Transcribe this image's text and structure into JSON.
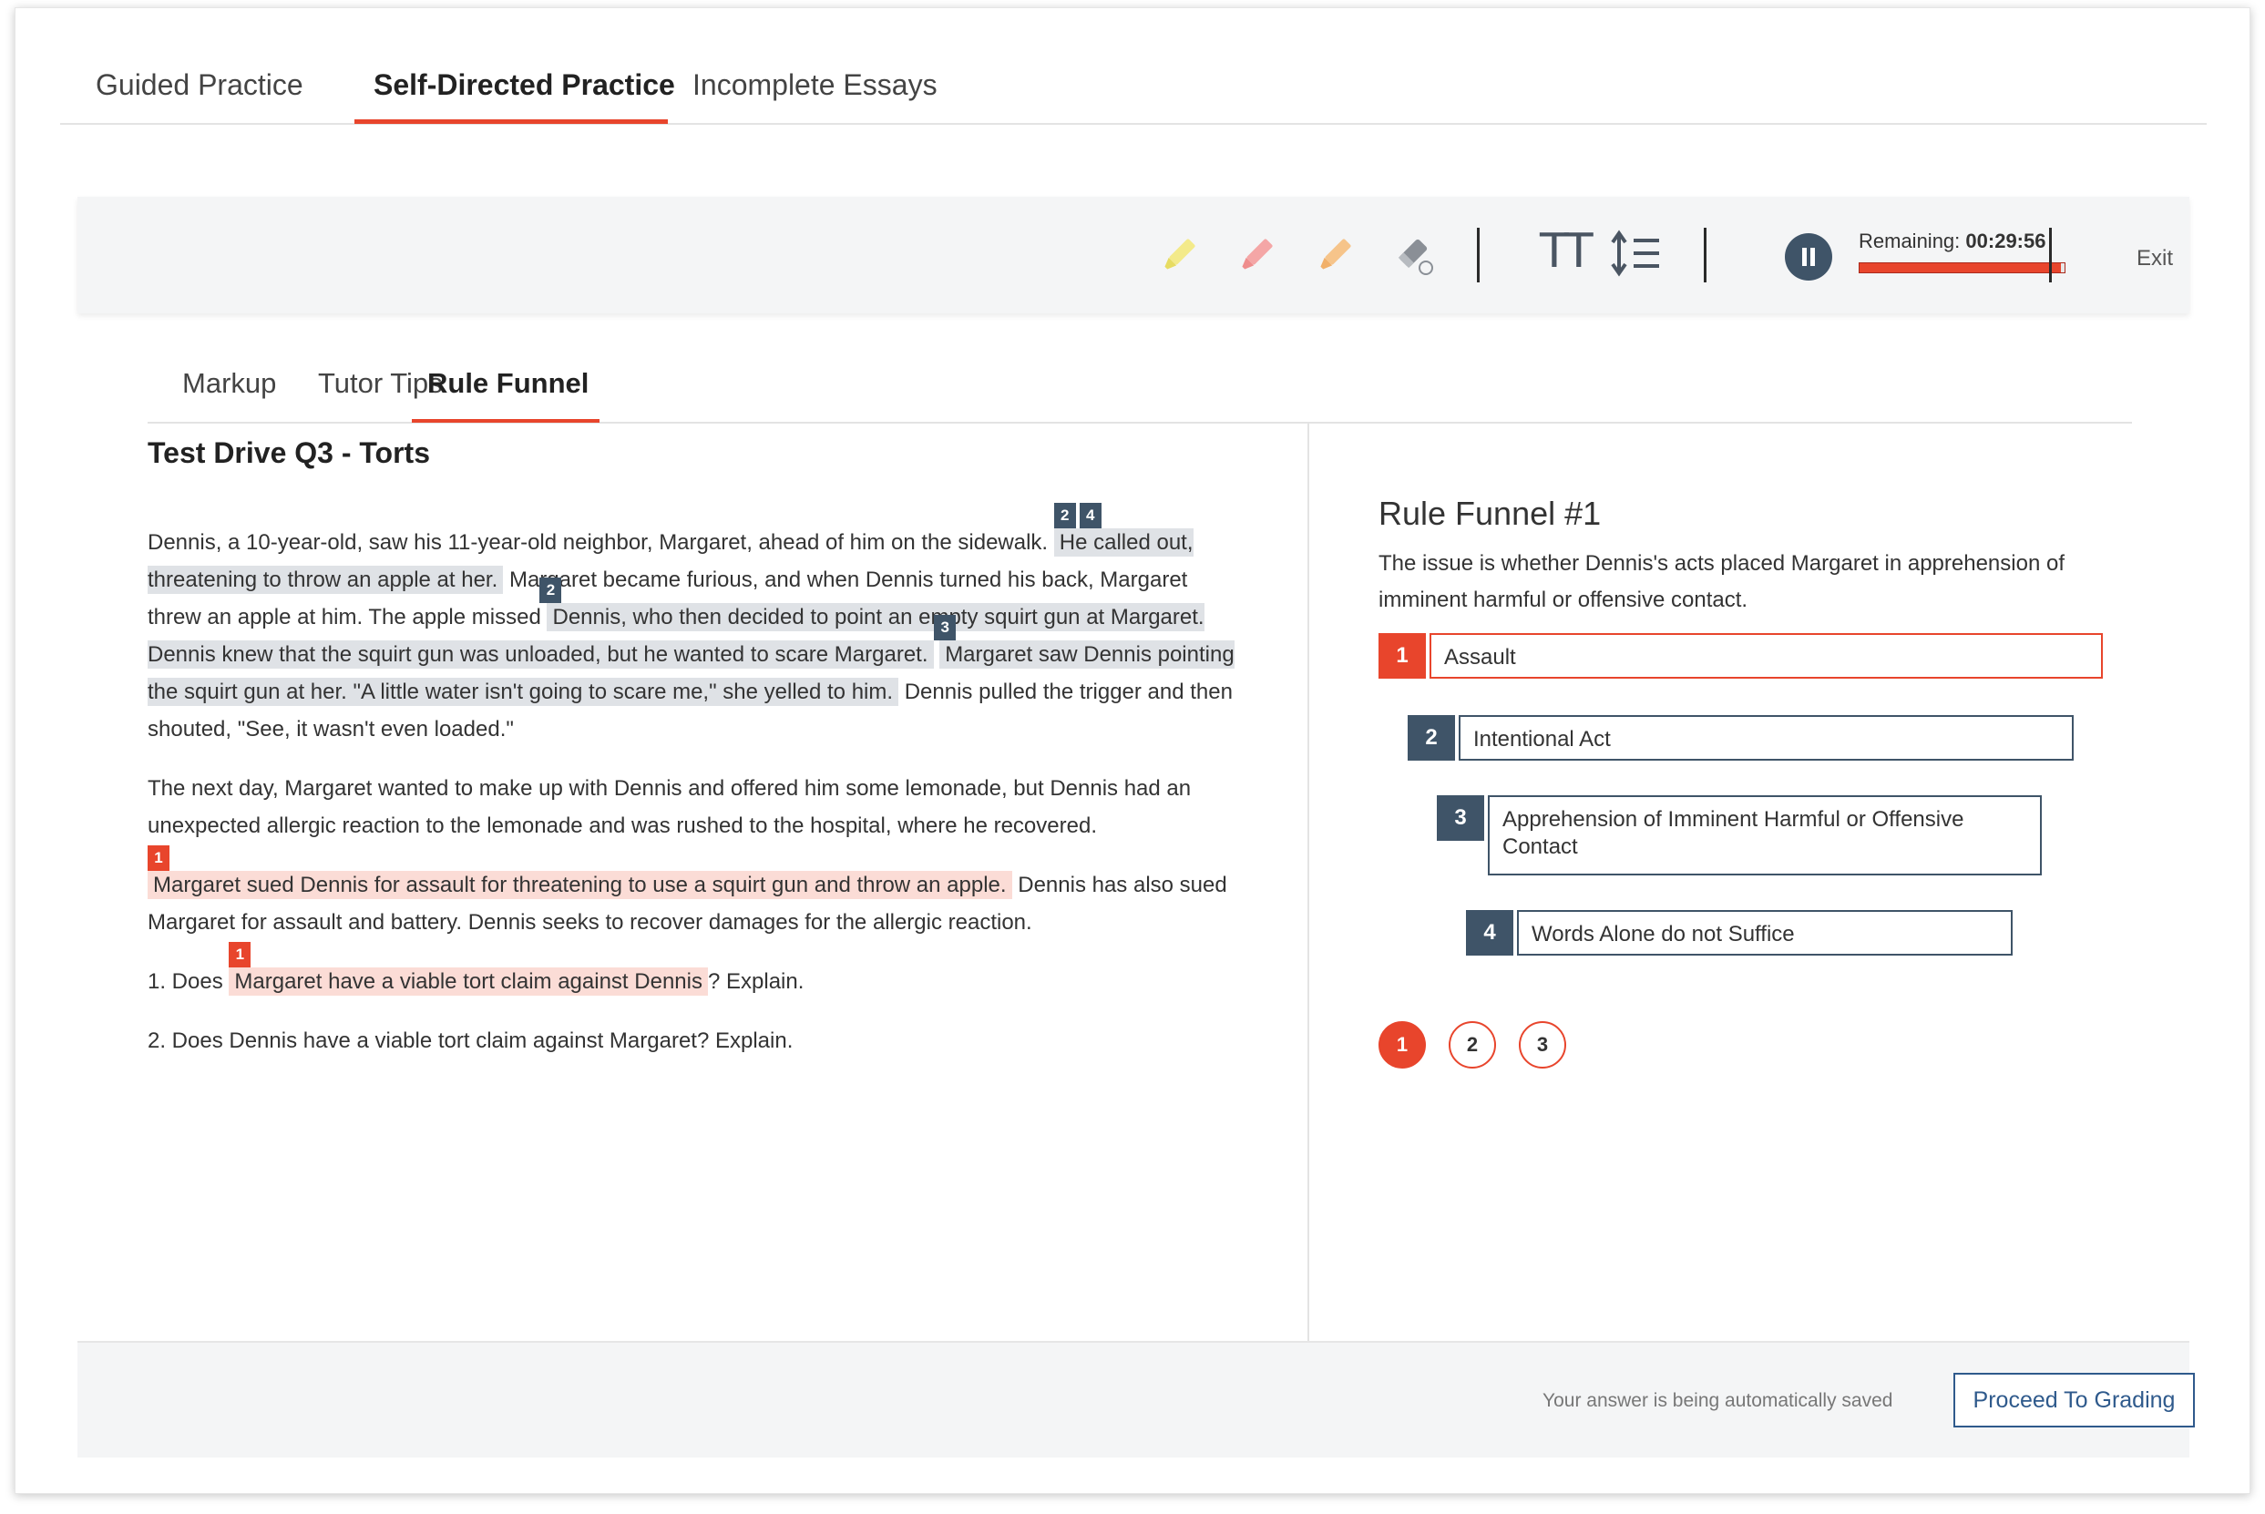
{
  "colors": {
    "accent": "#e8452c",
    "navy": "#3f5468",
    "link_blue": "#2f5a8c",
    "highlight_gray": "#dfe2e6",
    "highlight_pink": "#fbdcd6"
  },
  "top_tabs": [
    {
      "label": "Guided Practice"
    },
    {
      "label": "Self-Directed Practice",
      "active": true
    },
    {
      "label": "Incomplete Essays"
    }
  ],
  "toolbar": {
    "icons": [
      "yellow-highlighter-icon",
      "pink-highlighter-icon",
      "orange-highlighter-icon",
      "eraser-icon",
      "text-size-icon",
      "line-spacing-icon",
      "pause-icon"
    ],
    "text_size_glyph": "TT",
    "remaining_label": "Remaining:",
    "remaining_time": "00:29:56",
    "timer_progress": 0.98,
    "exit_label": "Exit"
  },
  "sub_tabs": [
    {
      "label": "Markup"
    },
    {
      "label": "Tutor Tips"
    },
    {
      "label": "Rule Funnel",
      "active": true
    }
  ],
  "question": {
    "title": "Test Drive Q3 - Torts",
    "p1": {
      "t1": "Dennis, a 10-year-old, saw his 11-year-old neighbor, Margaret, ahead of him on the sidewalk.",
      "h1": "He called out, threatening to throw an apple at her.",
      "h1_markers": [
        "2",
        "4"
      ],
      "t2": "Margaret became furious, and when Dennis turned his back, Margaret threw an apple at him. The apple missed",
      "h2": "Dennis, who then decided to point an empty squirt gun at Margaret. Dennis knew that the squirt gun was unloaded, but he wanted to scare Margaret.",
      "h2_marker": "2",
      "h3": "Margaret saw Dennis pointing the squirt gun at her. \"A little water isn't going to scare me,\" she yelled to him.",
      "h3_marker": "3",
      "t3": "Dennis pulled the trigger and then shouted, \"See, it wasn't even loaded.\""
    },
    "p2": "The next day, Margaret wanted to make up with Dennis and offered him some lemonade, but Dennis had an unexpected allergic reaction to the lemonade and was rushed to the hospital, where he recovered.",
    "p3": {
      "h": "Margaret sued Dennis for assault for threatening to use a squirt gun and throw an apple.",
      "marker": "1",
      "t": "Dennis has also sued Margaret for assault and battery. Dennis seeks to recover damages for the allergic reaction."
    },
    "q1": {
      "pre": "1. Does",
      "h": "Margaret have a viable tort claim against Dennis",
      "marker": "1",
      "post": "? Explain."
    },
    "q2": "2. Does Dennis have a viable tort claim against Margaret? Explain."
  },
  "rule_funnel": {
    "title": "Rule Funnel #1",
    "issue": "The issue is whether Dennis's acts placed Margaret in apprehension of imminent harmful or offensive contact.",
    "items": [
      {
        "num": "1",
        "text": "Assault"
      },
      {
        "num": "2",
        "text": "Intentional Act"
      },
      {
        "num": "3",
        "text": "Apprehension of Imminent Harmful or Offensive Contact"
      },
      {
        "num": "4",
        "text": "Words Alone do not Suffice"
      }
    ],
    "pages": [
      "1",
      "2",
      "3"
    ],
    "active_page": "1"
  },
  "footer": {
    "saved_message": "Your answer is being automatically saved",
    "proceed_label": "Proceed To Grading"
  }
}
